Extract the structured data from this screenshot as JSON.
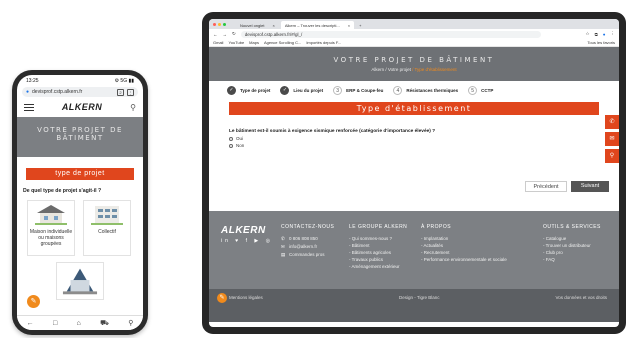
{
  "phone": {
    "status_time": "13:25",
    "status_icons": "⚙ 5G ▮▮",
    "url": "devisprof.cstp.alkern.fr",
    "logo": "ALKERN",
    "hero": "VOTRE PROJET DE BÂTIMENT",
    "banner": "type de projet",
    "question": "De quel type de projet s'agit-il ?",
    "cards": [
      {
        "label": "Maison individuelle ou maisons groupées"
      },
      {
        "label": "Collectif"
      }
    ],
    "bottom_nav": [
      "←",
      "□",
      "⌂",
      "⛟",
      "⚲"
    ]
  },
  "browser": {
    "tabs": [
      "Nouvel onglet",
      "Alkern – Trouver les descripti..."
    ],
    "url": "devisprof.cstp.alkern.fr/#/gl_/",
    "bookmarks": [
      "Gmail",
      "YouTube",
      "Maps",
      "Agence Scrolling C...",
      "Importés depuis F..."
    ],
    "bookmarks_right": "Tous les favoris"
  },
  "page": {
    "hero_title": "VOTRE PROJET DE BÂTIMENT",
    "hero_breadcrumb_prefix": "Alkern / Votre projet",
    "hero_breadcrumb_current": "/ Type d'établissement",
    "steps": [
      {
        "num": "✓",
        "label": "Type de projet",
        "done": true
      },
      {
        "num": "✓",
        "label": "Lieu du projet",
        "done": true
      },
      {
        "num": "3",
        "label": "ERP & Coupe-feu",
        "done": false
      },
      {
        "num": "4",
        "label": "Résistances thermiques",
        "done": false
      },
      {
        "num": "5",
        "label": "CCTP",
        "done": false
      }
    ],
    "section_title": "Type d'établissement",
    "question": "Le bâtiment est-il soumis à exigence sismique renforcée (catégorie d'importance élevée) ?",
    "options": [
      "Oui",
      "Non"
    ],
    "prev_label": "Précédent",
    "next_label": "Suivant"
  },
  "footer": {
    "logo": "ALKERN",
    "social": "in ♥ f ▶ ◎",
    "contact_title": "CONTACTEZ-NOUS",
    "phone": "0 806 808 850",
    "email": "info@alkern.fr",
    "orders": "Commandes pros",
    "group_title": "LE GROUPE ALKERN",
    "group_items": [
      "- Qui sommes-nous ?",
      "- Bâtiment",
      "- Bâtiments agricoles",
      "- Travaux publics",
      "- Aménagement extérieur"
    ],
    "about_title": "À PROPOS",
    "about_items": [
      "- Implantation",
      "- Actualités",
      "- Recrutement",
      "- Performance environnementale et sociale"
    ],
    "tools_title": "OUTILS & SERVICES",
    "tools_items": [
      "- Catalogue",
      "- Trouver un distributeur",
      "- Club pro",
      "- FAQ"
    ],
    "bottom_left": "Mentions légales",
    "bottom_center": "Design - Tigre Blanc",
    "bottom_right": "Vos données et vos droits"
  },
  "colors": {
    "accent": "#e0461d",
    "fab": "#f08a1c",
    "hero_bg": "#6e7175"
  }
}
